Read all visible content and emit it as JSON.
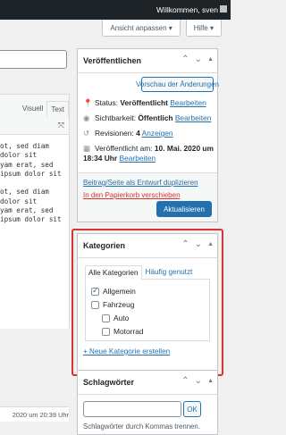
{
  "adminbar": {
    "welcome": "Willkommen, sven"
  },
  "screen_options": {
    "anpassen": "Ansicht anpassen ▾",
    "hilfe": "Hilfe ▾"
  },
  "editor": {
    "tab_visual": "Visuell",
    "tab_text": "Text",
    "lines": [
      "ot, sed diam",
      "dolor sit",
      "yam erat, sed",
      "ipsum dolor sit",
      "",
      "ot, sed diam",
      "dolor sit",
      "yam erat, sed",
      "ipsum dolor sit"
    ],
    "last_edit": "2020 um 20:39 Uhr"
  },
  "publish": {
    "title": "Veröffentlichen",
    "preview_btn": "Vorschau der Änderungen",
    "status_label": "Status: ",
    "status_value": "Veröffentlicht",
    "status_edit": "Bearbeiten",
    "visibility_label": "Sichtbarkeit: ",
    "visibility_value": "Öffentlich",
    "visibility_edit": "Bearbeiten",
    "revisions_label": "Revisionen: ",
    "revisions_value": "4",
    "revisions_link": "Anzeigen",
    "published_label": "Veröffentlicht am: ",
    "published_date": "10. Mai. 2020 um",
    "published_time": "18:34 Uhr",
    "published_edit": "Bearbeiten",
    "duplicate_link": "Beitrag/Seite als Entwurf duplizieren",
    "trash_link": "In den Papierkorb verschieben",
    "update_btn": "Aktualisieren"
  },
  "categories": {
    "title": "Kategorien",
    "tab_all": "Alle Kategorien",
    "tab_used": "Häufig genutzt",
    "items": [
      {
        "label": "Allgemein",
        "checked": true
      },
      {
        "label": "Fahrzeug",
        "checked": false
      },
      {
        "label": "Auto",
        "checked": false
      },
      {
        "label": "Motorrad",
        "checked": false
      }
    ],
    "new_link": "+ Neue Kategorie erstellen"
  },
  "tags": {
    "title": "Schlagwörter",
    "ok_btn": "OK",
    "hint": "Schlagwörter durch Kommas trennen."
  }
}
